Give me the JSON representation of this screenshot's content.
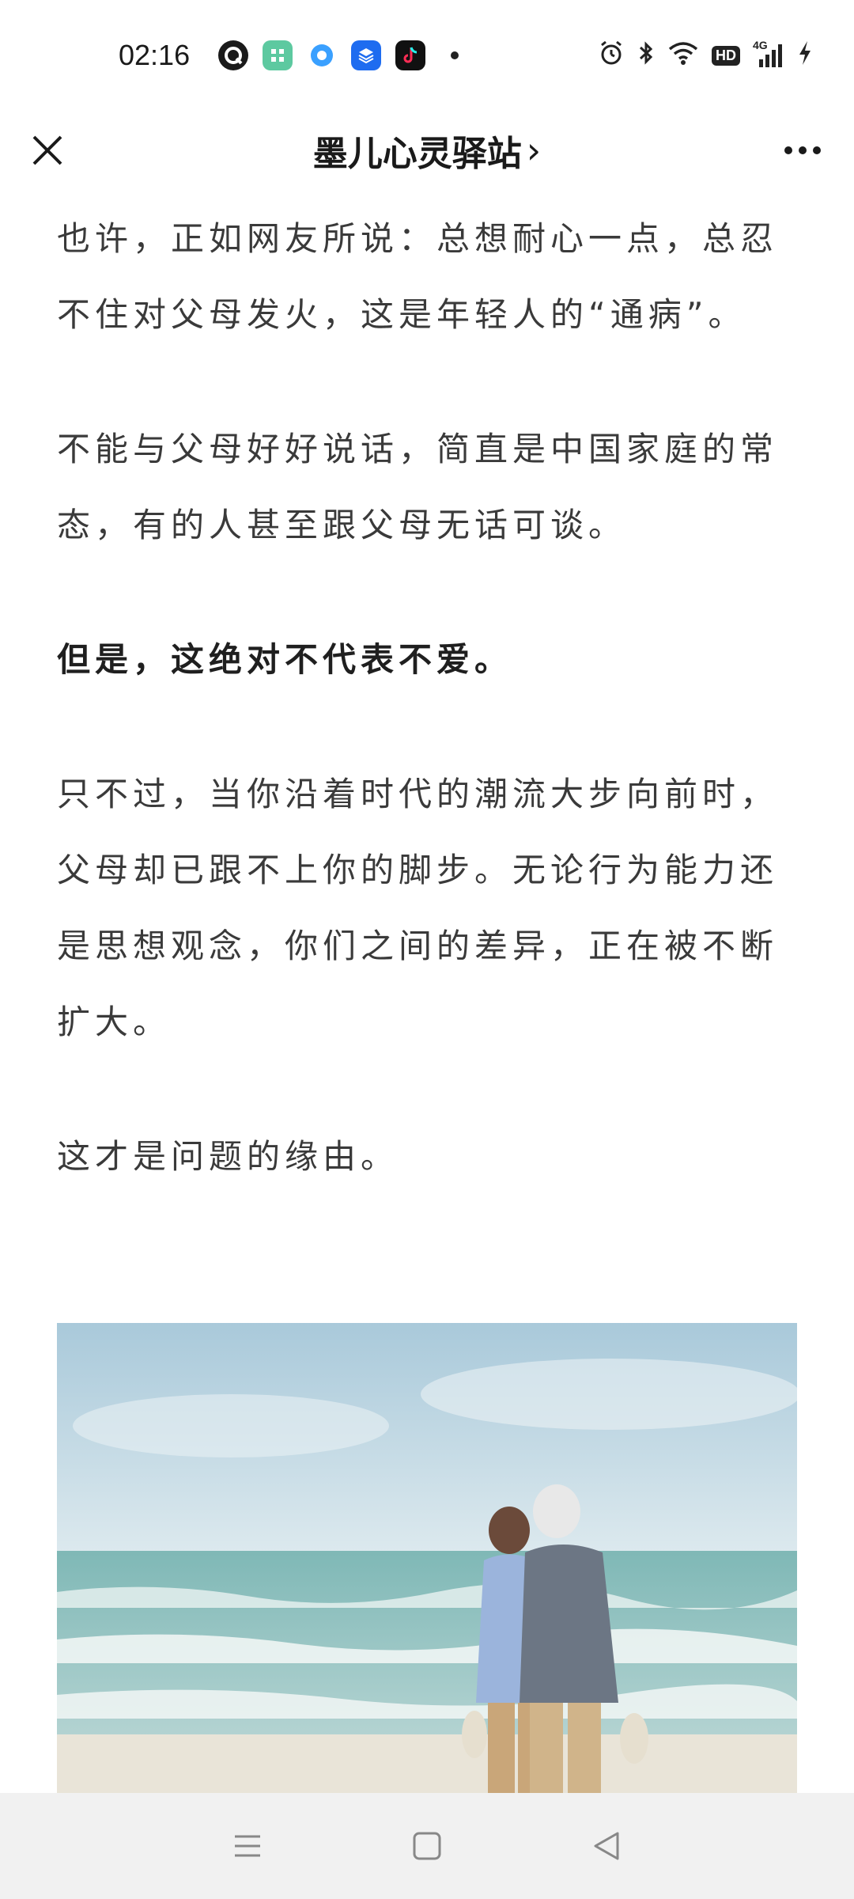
{
  "status_bar": {
    "time": "02:16",
    "apps": [
      {
        "icon": "messenger-icon",
        "color": "#1a1a1a",
        "glyph": "Q"
      },
      {
        "icon": "mini-app-icon",
        "color": "#5dc9a0",
        "glyph": "⌘"
      },
      {
        "icon": "browser-icon",
        "color": "#3aa0ff",
        "glyph": "●"
      },
      {
        "icon": "layers-app-icon",
        "color": "#1e6cf0",
        "glyph": "≡"
      },
      {
        "icon": "tiktok-icon",
        "color": "#111111",
        "glyph": "♪"
      }
    ],
    "network": "4G",
    "hd_label": "HD"
  },
  "nav": {
    "title": "墨儿心灵驿站",
    "title_suffix": "›"
  },
  "article": {
    "paragraphs": [
      {
        "text": "也许，正如网友所说：总想耐心一点，总忍不住对父母发火，这是年轻人的“通病”。",
        "bold": false
      },
      {
        "text": "不能与父母好好说话，简直是中国家庭的常态，有的人甚至跟父母无话可谈。",
        "bold": false
      },
      {
        "text": "但是，这绝对不代表不爱。",
        "bold": true
      },
      {
        "text": "只不过，当你沿着时代的潮流大步向前时，父母却已跟不上你的脚步。无论行为能力还是思想观念，你们之间的差异，正在被不断扩大。",
        "bold": false
      },
      {
        "text": "这才是问题的缘由。",
        "bold": false
      }
    ]
  },
  "colors": {
    "accent_text": "#1f1f1f",
    "body_text": "#3a3a3a",
    "sky": "#c7dde8",
    "sea": "#8fc3c0"
  }
}
